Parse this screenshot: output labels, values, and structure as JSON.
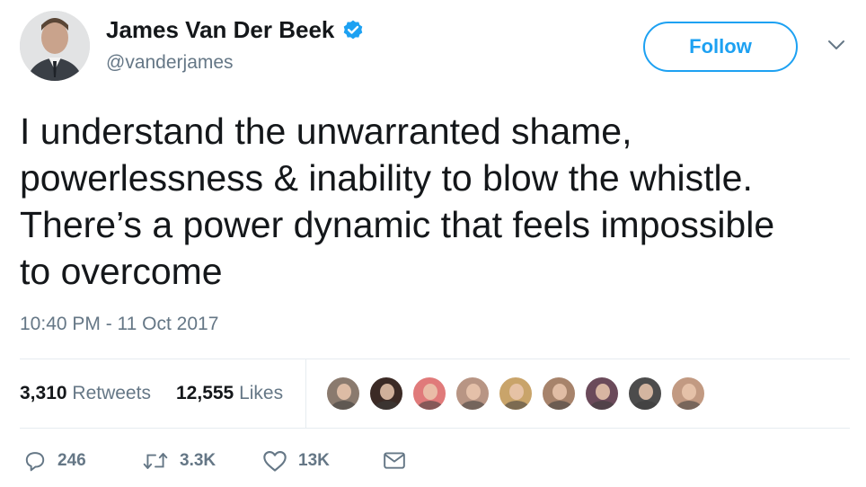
{
  "tweet": {
    "author": {
      "name": "James Van Der Beek",
      "handle": "@vanderjames",
      "verified_icon": "verified-badge-icon"
    },
    "follow_label": "Follow",
    "text": "I understand the unwarranted shame,\npowerlessness & inability to blow the whistle.\nThere’s a power dynamic that feels impossible\nto overcome",
    "timestamp": "10:40 PM - 11 Oct 2017",
    "stats": {
      "retweets": {
        "count": "3,310",
        "label": "Retweets"
      },
      "likes": {
        "count": "12,555",
        "label": "Likes"
      }
    },
    "liker_avatars": [
      {
        "name": "liker-avatar-1",
        "color": "#8a7a6e"
      },
      {
        "name": "liker-avatar-2",
        "color": "#3b2a25"
      },
      {
        "name": "liker-avatar-3",
        "color": "#e07a7a"
      },
      {
        "name": "liker-avatar-4",
        "color": "#b89584"
      },
      {
        "name": "liker-avatar-5",
        "color": "#c9a46a"
      },
      {
        "name": "liker-avatar-6",
        "color": "#a7836b"
      },
      {
        "name": "liker-avatar-7",
        "color": "#6b4a5a"
      },
      {
        "name": "liker-avatar-8",
        "color": "#4c4c4c"
      },
      {
        "name": "liker-avatar-9",
        "color": "#c29a82"
      }
    ],
    "actions": {
      "reply": {
        "icon": "reply-icon",
        "count": "246"
      },
      "retweet": {
        "icon": "retweet-icon",
        "count": "3.3K"
      },
      "like": {
        "icon": "heart-icon",
        "count": "13K"
      },
      "message": {
        "icon": "envelope-icon"
      }
    },
    "colors": {
      "accent": "#1da1f2",
      "text": "#14171a",
      "secondary": "#657786",
      "divider": "#e6ecf0"
    }
  }
}
